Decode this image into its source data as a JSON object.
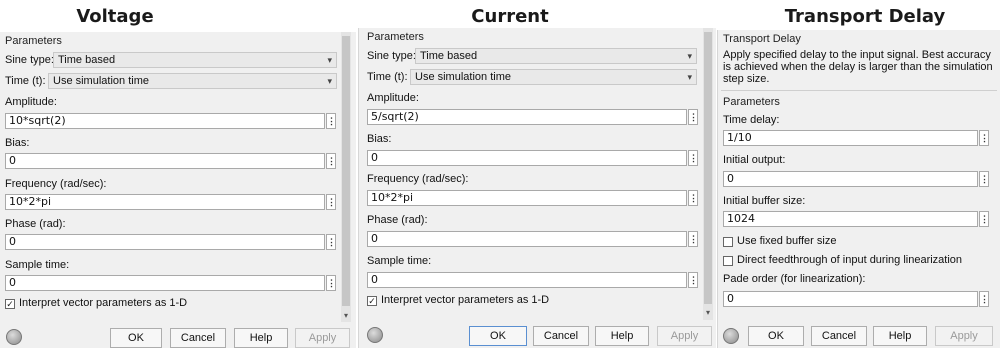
{
  "headings": {
    "voltage": "Voltage",
    "current": "Current",
    "transport_delay": "Transport Delay"
  },
  "voltage": {
    "parameters_title": "Parameters",
    "sine_type_label": "Sine type:",
    "sine_type_value": "Time based",
    "time_label": "Time (t):",
    "time_value": "Use simulation time",
    "amplitude_label": "Amplitude:",
    "amplitude_value": "10*sqrt(2)",
    "bias_label": "Bias:",
    "bias_value": "0",
    "frequency_label": "Frequency (rad/sec):",
    "frequency_value": "10*2*pi",
    "phase_label": "Phase (rad):",
    "phase_value": "0",
    "sample_time_label": "Sample time:",
    "sample_time_value": "0",
    "interpret_label": "Interpret vector parameters as 1-D",
    "interpret_checked": true,
    "ok": "OK",
    "cancel": "Cancel",
    "help": "Help",
    "apply": "Apply"
  },
  "current": {
    "parameters_title": "Parameters",
    "sine_type_label": "Sine type:",
    "sine_type_value": "Time based",
    "time_label": "Time (t):",
    "time_value": "Use simulation time",
    "amplitude_label": "Amplitude:",
    "amplitude_value": "5/sqrt(2)",
    "bias_label": "Bias:",
    "bias_value": "0",
    "frequency_label": "Frequency (rad/sec):",
    "frequency_value": "10*2*pi",
    "phase_label": "Phase (rad):",
    "phase_value": "0",
    "sample_time_label": "Sample time:",
    "sample_time_value": "0",
    "interpret_label": "Interpret vector parameters as 1-D",
    "interpret_checked": true,
    "ok": "OK",
    "cancel": "Cancel",
    "help": "Help",
    "apply": "Apply"
  },
  "transport": {
    "block_title": "Transport Delay",
    "description": "Apply specified delay to the input signal.  Best accuracy is achieved when the delay is larger than the simulation step size.",
    "parameters_title": "Parameters",
    "time_delay_label": "Time delay:",
    "time_delay_value": "1/10",
    "initial_output_label": "Initial output:",
    "initial_output_value": "0",
    "buffer_size_label": "Initial buffer size:",
    "buffer_size_value": "1024",
    "fixed_buffer_label": "Use fixed buffer size",
    "fixed_buffer_checked": false,
    "direct_feedthrough_label": "Direct feedthrough of input during linearization",
    "direct_feedthrough_checked": false,
    "pade_label": "Pade order (for linearization):",
    "pade_value": "0",
    "ok": "OK",
    "cancel": "Cancel",
    "help": "Help",
    "apply": "Apply"
  },
  "icons": {
    "field_menu": "⋮",
    "dropdown": "▾",
    "check": "✓",
    "scroll_up": "▴",
    "scroll_down": "▾"
  }
}
